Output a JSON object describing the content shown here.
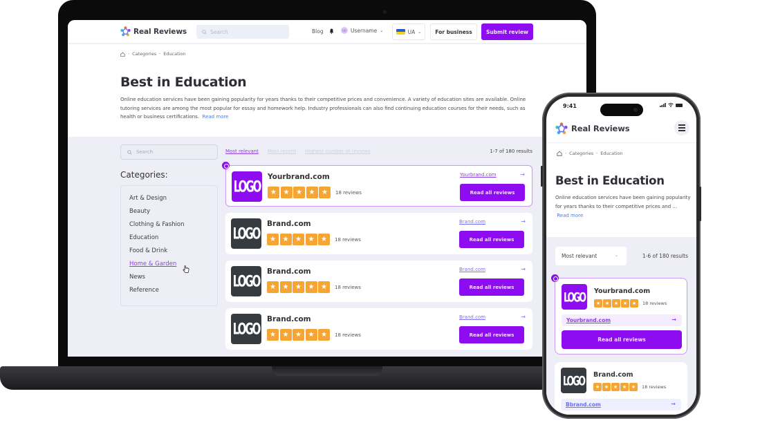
{
  "brand": {
    "name": "Real Reviews",
    "accent": "#8d0cf0",
    "star_color": "#f4a533",
    "link_color": "#4f7be6"
  },
  "desktop": {
    "header": {
      "search_placeholder": "Search",
      "blog": "Blog",
      "username": "Username",
      "avatar_initials": "UR",
      "language": "UA",
      "for_business": "For business",
      "submit_review": "Submit review"
    },
    "breadcrumb": [
      "Categories",
      "Education"
    ],
    "title": "Best in Education",
    "description": "Online education services have been gaining popularity for years thanks to their competitive prices and convenience. A variety of education sites are available. Online tutoring services are among the most popular for essay and homework help. Industry professionals can also find continuing education courses for their needs, such as health or business certifications.",
    "read_more": "Read more",
    "sidebar_search_placeholder": "Search",
    "sort_tabs": [
      {
        "label": "Most relevant",
        "active": true
      },
      {
        "label": "Most recent",
        "active": false
      },
      {
        "label": "Highest number of reviews",
        "active": false
      }
    ],
    "results_count": "1-7 of 180 results",
    "categories_title": "Categories:",
    "categories": [
      "Art & Design",
      "Beauty",
      "Clothing & Fashion",
      "Education",
      "Food & Drink",
      "Home & Garden",
      "News",
      "Reference"
    ],
    "hovered_category": "Home & Garden",
    "listings": [
      {
        "logo": "LOGO",
        "name": "Yourbrand.com",
        "rating": 5,
        "reviews": "18 reviews",
        "link": "Yourbrand.com",
        "button": "Read all reviews",
        "featured": true
      },
      {
        "logo": "LOGO",
        "name": "Brand.com",
        "rating": 5,
        "reviews": "18 reviews",
        "link": "Brand.com",
        "button": "Read all reviews",
        "featured": false
      },
      {
        "logo": "LOGO",
        "name": "Brand.com",
        "rating": 5,
        "reviews": "18 reviews",
        "link": "Brand.com",
        "button": "Read all reviews",
        "featured": false
      },
      {
        "logo": "LOGO",
        "name": "Brand.com",
        "rating": 5,
        "reviews": "18 reviews",
        "link": "Brand.com",
        "button": "Read all reviews",
        "featured": false
      }
    ]
  },
  "mobile": {
    "time": "9:41",
    "breadcrumb": [
      "Categories",
      "Education"
    ],
    "title": "Best in Education",
    "description": "Online education services have been gaining popularity for years thanks to their competitive prices and ...",
    "read_more": "Read more",
    "sort_selected": "Most relevant",
    "results_count": "1-6 of 180 results",
    "listings": [
      {
        "logo": "LOGO",
        "name": "Yourbrand.com",
        "rating": 5,
        "reviews": "18 reviews",
        "link": "Yourbrand.com",
        "button": "Read all reviews",
        "featured": true
      },
      {
        "logo": "LOGO",
        "name": "Brand.com",
        "rating": 5,
        "reviews": "18 reviews",
        "link": "Bbrand.com",
        "featured": false
      }
    ]
  },
  "icons": {
    "arrow": "→",
    "chevron": "⌄",
    "star": "★",
    "home": "⌂"
  }
}
